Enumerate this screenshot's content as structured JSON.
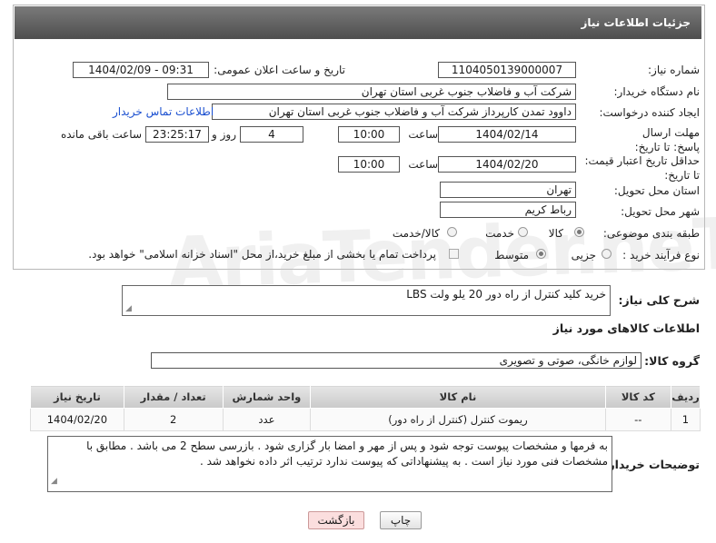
{
  "header": {
    "title": "جزئیات اطلاعات نیاز"
  },
  "watermark": "AriaTender.neT",
  "fields": {
    "need_number_label": "شماره نیاز:",
    "need_number": "1104050139000007",
    "announce_label": "تاریخ و ساعت اعلان عمومی:",
    "announce_value": "1404/02/09 - 09:31",
    "buyer_label": "نام دستگاه خریدار:",
    "buyer_value": "شرکت آب و فاضلاب جنوب غربی استان تهران",
    "creator_label": "ایجاد کننده درخواست:",
    "creator_value": "داوود  تمدن  کارپرداز شرکت آب و فاضلاب جنوب غربی استان تهران",
    "contact_link": "اطلاعات تماس خریدار",
    "deadline_label": "مهلت ارسال پاسخ: تا تاریخ:",
    "deadline_date": "1404/02/14",
    "time_label": "ساعت",
    "deadline_time": "10:00",
    "days_value": "4",
    "days_label": "روز و",
    "remaining_time": "23:25:17",
    "remaining_label": "ساعت باقی مانده",
    "validity_label": "حداقل تاریخ اعتبار قیمت: تا تاریخ:",
    "validity_date": "1404/02/20",
    "validity_time_label": "ساعت",
    "validity_time": "10:00",
    "province_label": "استان محل تحویل:",
    "province_value": "تهران",
    "city_label": "شهر محل تحویل:",
    "city_value": "رباط کریم",
    "category_label": "طبقه بندی موضوعی:",
    "category_options": [
      "کالا",
      "خدمت",
      "کالا/خدمت"
    ],
    "category_selected": "کالا",
    "purchase_type_label": "نوع فرآیند خرید :",
    "purchase_options": [
      "جزیی",
      "متوسط"
    ],
    "purchase_selected": "متوسط",
    "payment_note": "پرداخت تمام یا بخشی از مبلغ خرید،از محل \"اسناد خزانه اسلامی\" خواهد بود."
  },
  "summary": {
    "label": "شرح کلی نیاز:",
    "value": "خرید کلید کنترل از راه دور 20 یلو ولت LBS"
  },
  "goods_section": {
    "title": "اطلاعات کالاهای مورد نیاز",
    "group_label": "گروه کالا:",
    "group_value": "لوازم خانگی، صوتی و تصویری"
  },
  "table": {
    "headers": [
      "ردیف",
      "کد کالا",
      "نام کالا",
      "واحد شمارش",
      "تعداد / مقدار",
      "تاریخ نیاز"
    ],
    "rows": [
      [
        "1",
        "--",
        "ریموت کنترل (کنترل از راه دور)",
        "عدد",
        "2",
        "1404/02/20"
      ]
    ]
  },
  "buyer_notes": {
    "label": "توضیحات خریدار:",
    "value": "به فرمها و مشخصات پیوست توجه شود و پس از مهر و امضا بار گزاری شود . بازرسی سطح 2 می باشد . مطابق با مشخصات فنی مورد نیاز است .  به پیشنهاداتی که پیوست ندارد ترتیب اثر داده نخواهد شد ."
  },
  "buttons": {
    "print": "چاپ",
    "back": "بازگشت"
  }
}
